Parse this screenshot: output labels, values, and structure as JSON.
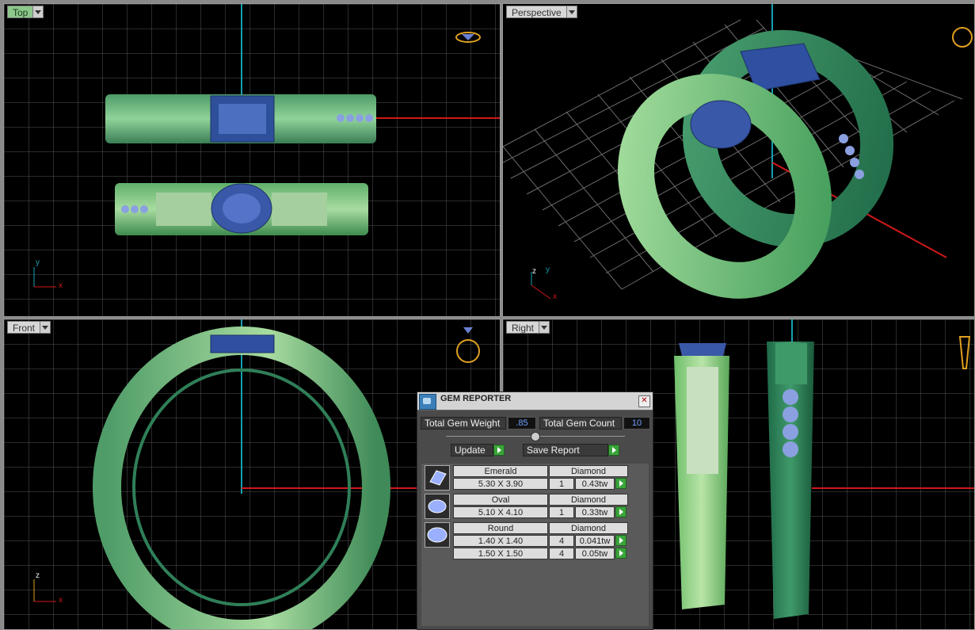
{
  "viewports": {
    "top": {
      "label": "Top"
    },
    "perspective": {
      "label": "Perspective"
    },
    "front": {
      "label": "Front"
    },
    "right": {
      "label": "Right"
    }
  },
  "axes": {
    "x": "x",
    "y": "y",
    "z": "z"
  },
  "gem_reporter": {
    "title": "GEM REPORTER",
    "total_weight_label": "Total Gem Weight",
    "total_weight_value": ".85",
    "total_count_label": "Total Gem Count",
    "total_count_value": "10",
    "update_label": "Update",
    "save_label": "Save Report",
    "gems": [
      {
        "cut": "Emerald",
        "material": "Diamond",
        "rows": [
          {
            "size": "5.30 X 3.90",
            "count": "1",
            "weight": "0.43tw"
          }
        ]
      },
      {
        "cut": "Oval",
        "material": "Diamond",
        "rows": [
          {
            "size": "5.10 X 4.10",
            "count": "1",
            "weight": "0.33tw"
          }
        ]
      },
      {
        "cut": "Round",
        "material": "Diamond",
        "rows": [
          {
            "size": "1.40 X 1.40",
            "count": "4",
            "weight": "0.041tw"
          },
          {
            "size": "1.50 X 1.50",
            "count": "4",
            "weight": "0.05tw"
          }
        ]
      }
    ]
  },
  "colors": {
    "ring_green": "#6fbf7a",
    "ring_dark": "#2f8a5a",
    "gem_blue": "#3f5fa8",
    "grid": "#5a5a5a",
    "axis_red": "#d01818",
    "axis_cyan": "#14a0b0"
  }
}
